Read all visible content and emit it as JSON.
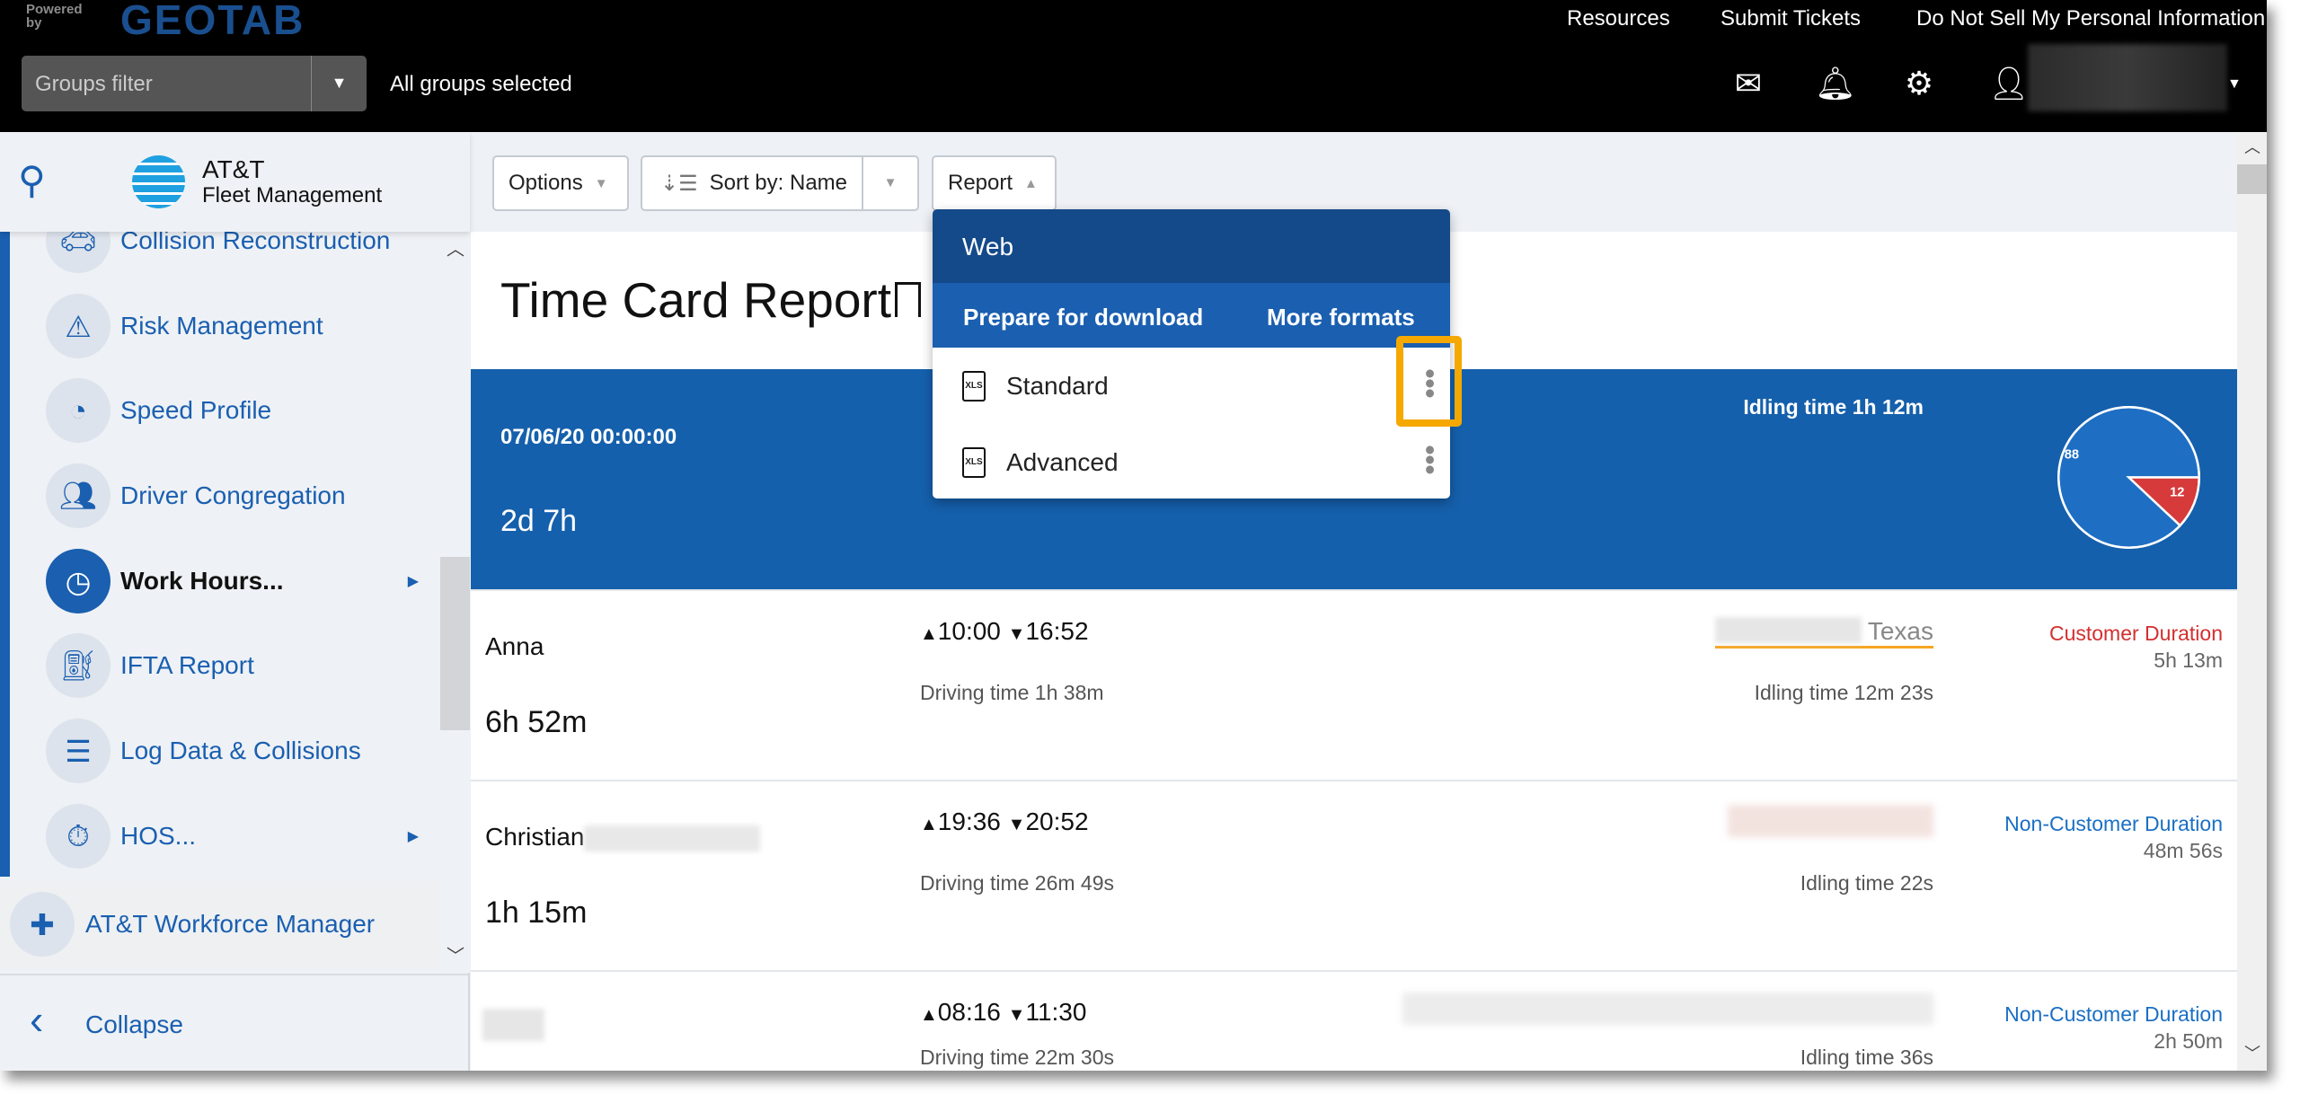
{
  "topbar": {
    "powered_by": "Powered by",
    "brand": "GEOTAB",
    "groups_filter_placeholder": "Groups filter",
    "groups_status": "All groups selected",
    "links": [
      "Resources",
      "Submit Tickets",
      "Do Not Sell My Personal Information"
    ]
  },
  "sidebar": {
    "brand_line1": "AT&T",
    "brand_line2": "Fleet Management",
    "items": [
      {
        "label": "Collision Reconstruction",
        "icon": "car-collision-icon"
      },
      {
        "label": "Risk Management",
        "icon": "risk-chart-icon"
      },
      {
        "label": "Speed Profile",
        "icon": "speedometer-icon"
      },
      {
        "label": "Driver Congregation",
        "icon": "people-pin-icon"
      },
      {
        "label": "Work Hours...",
        "icon": "clock-icon",
        "active": true
      },
      {
        "label": "IFTA Report",
        "icon": "fuel-can-icon"
      },
      {
        "label": "Log Data & Collisions",
        "icon": "log-warning-icon"
      },
      {
        "label": "HOS...",
        "icon": "stopwatch-icon"
      }
    ],
    "workforce": "AT&T Workforce Manager",
    "collapse": "Collapse"
  },
  "toolbar": {
    "options": "Options",
    "sort_prefix": "Sort by:",
    "sort_value": "Name",
    "report": "Report"
  },
  "report_menu": {
    "web": "Web",
    "prepare": "Prepare for download",
    "more": "More formats",
    "items": [
      "Standard",
      "Advanced"
    ],
    "file_badge": "XLS",
    "highlight_color": "#f5a800"
  },
  "page": {
    "title": "Time Card Report"
  },
  "summary": {
    "date": "07/06/20 00:00:00",
    "total": "2d 7h",
    "idling": "Idling time 1h 12m",
    "pie": {
      "values": [
        88,
        12
      ],
      "colors": [
        "#1e6fc4",
        "#d63a3a"
      ]
    }
  },
  "rows": [
    {
      "name": "Anna",
      "duration": "6h 52m",
      "start": "10:00",
      "end": "16:52",
      "driving": "Driving time 1h 38m",
      "location": "Texas",
      "idling": "Idling time 12m 23s",
      "type": "Customer Duration",
      "type_color": "#d32f2f",
      "type_duration": "5h 13m"
    },
    {
      "name": "Christian",
      "duration": "1h 15m",
      "start": "19:36",
      "end": "20:52",
      "driving": "Driving time 26m 49s",
      "location": "",
      "idling": "Idling time 22s",
      "type": "Non-Customer Duration",
      "type_color": "#1a6fc4",
      "type_duration": "48m 56s"
    },
    {
      "name": "",
      "duration": "",
      "start": "08:16",
      "end": "11:30",
      "driving": "Driving time 22m 30s",
      "location": "",
      "idling": "Idling time 36s",
      "type": "Non-Customer Duration",
      "type_color": "#1a6fc4",
      "type_duration": "2h 50m"
    }
  ]
}
